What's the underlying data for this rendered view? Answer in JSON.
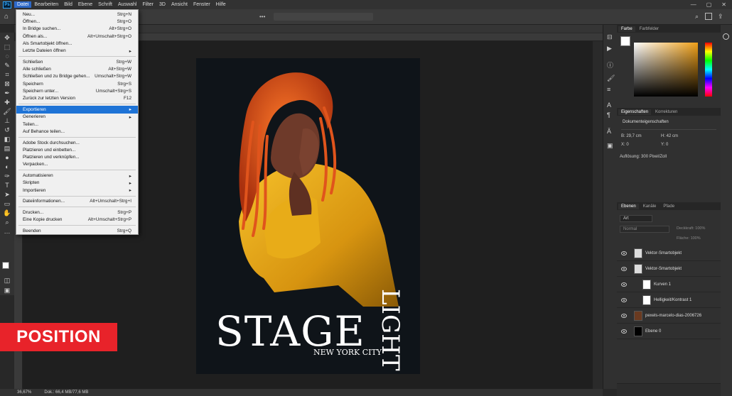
{
  "menubar": {
    "items": [
      "Datei",
      "Bearbeiten",
      "Bild",
      "Ebene",
      "Schrift",
      "Auswahl",
      "Filter",
      "3D",
      "Ansicht",
      "Fenster",
      "Hilfe"
    ],
    "active": "Datei"
  },
  "menu": {
    "entries": [
      {
        "label": "Neu...",
        "shortcut": "Strg+N"
      },
      {
        "label": "Öffnen...",
        "shortcut": "Strg+O"
      },
      {
        "label": "In Bridge suchen...",
        "shortcut": "Alt+Strg+O"
      },
      {
        "label": "Öffnen als...",
        "shortcut": "Alt+Umschalt+Strg+O"
      },
      {
        "label": "Als Smartobjekt öffnen...",
        "shortcut": ""
      },
      {
        "label": "Letzte Dateien öffnen",
        "shortcut": "",
        "submenu": true
      },
      {
        "sep": true
      },
      {
        "label": "Schließen",
        "shortcut": "Strg+W"
      },
      {
        "label": "Alle schließen",
        "shortcut": "Alt+Strg+W"
      },
      {
        "label": "Schließen und zu Bridge gehen...",
        "shortcut": "Umschalt+Strg+W"
      },
      {
        "label": "Speichern",
        "shortcut": "Strg+S"
      },
      {
        "label": "Speichern unter...",
        "shortcut": "Umschalt+Strg+S"
      },
      {
        "label": "Zurück zur letzten Version",
        "shortcut": "F12"
      },
      {
        "sep": true
      },
      {
        "label": "Exportieren",
        "shortcut": "",
        "submenu": true,
        "highlight": true
      },
      {
        "label": "Generieren",
        "shortcut": "",
        "submenu": true
      },
      {
        "label": "Teilen...",
        "shortcut": ""
      },
      {
        "label": "Auf Behance teilen...",
        "shortcut": ""
      },
      {
        "sep": true
      },
      {
        "label": "Adobe Stock durchsuchen...",
        "shortcut": ""
      },
      {
        "label": "Platzieren und einbetten...",
        "shortcut": ""
      },
      {
        "label": "Platzieren und verknüpfen...",
        "shortcut": ""
      },
      {
        "label": "Verpacken...",
        "shortcut": ""
      },
      {
        "sep": true
      },
      {
        "label": "Automatisieren",
        "shortcut": "",
        "submenu": true
      },
      {
        "label": "Skripten",
        "shortcut": "",
        "submenu": true
      },
      {
        "label": "Importieren",
        "shortcut": "",
        "submenu": true
      },
      {
        "sep": true
      },
      {
        "label": "Dateiinformationen...",
        "shortcut": "Alt+Umschalt+Strg+I"
      },
      {
        "sep": true
      },
      {
        "label": "Drucken...",
        "shortcut": "Strg+P"
      },
      {
        "label": "Eine Kopie drucken",
        "shortcut": "Alt+Umschalt+Strg+P"
      },
      {
        "sep": true
      },
      {
        "label": "Beenden",
        "shortcut": "Strg+Q"
      }
    ]
  },
  "poster": {
    "title": "STAGE",
    "vertical": "LIGHT",
    "subtitle": "NEW YORK CITY"
  },
  "statusbar": {
    "zoom": "36,67%",
    "doc": "Dok.: 66,4 MB/77,6 MB"
  },
  "color_panel": {
    "tabs": [
      "Farbe",
      "Farbfelder"
    ]
  },
  "properties": {
    "tabs": [
      "Eigenschaften",
      "Korrekturen"
    ],
    "header": "Dokumenteigenschaften",
    "width": "B: 29,7 cm",
    "height": "H: 42 cm",
    "x": "X: 0",
    "y": "Y: 0",
    "resolution": "Auflösung: 300 Pixel/Zoll"
  },
  "layers": {
    "tabs": [
      "Ebenen",
      "Kanäle",
      "Pfade"
    ],
    "filter": "Art",
    "blend": "Normal",
    "opacity_label": "Deckkraft: 100%",
    "fill_label": "Fläche: 100%",
    "items": [
      {
        "name": "Vektor-Smartobjekt"
      },
      {
        "name": "Vektor-Smartobjekt"
      },
      {
        "name": "Kurven 1"
      },
      {
        "name": "Helligkeit/Kontrast 1"
      },
      {
        "name": "pexels-marcelo-dias-2006726"
      },
      {
        "name": "Ebene 0"
      }
    ]
  },
  "overlay": {
    "label": "POSITION"
  },
  "colors": {
    "accent": "#1e73d6",
    "badge": "#e8232a",
    "poster_yellow": "#e2a414",
    "hair_orange": "#e0541c"
  }
}
